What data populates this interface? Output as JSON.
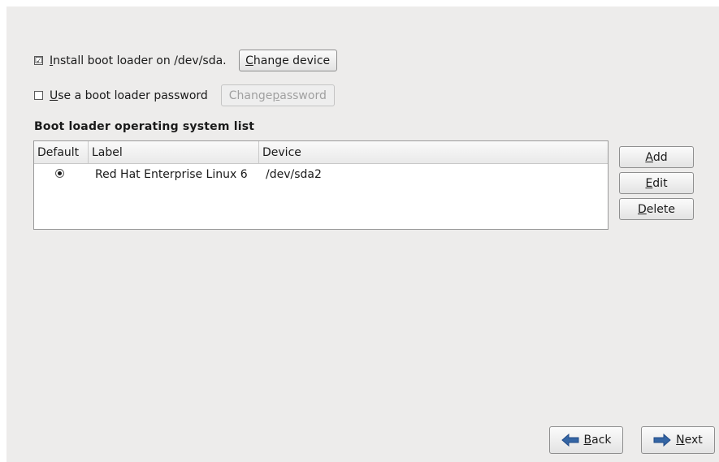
{
  "install": {
    "checked": true,
    "check_glyph": "☑",
    "label_prefix": "I",
    "label_rest": "nstall boot loader on /dev/sda.",
    "change_device_prefix": "C",
    "change_device_rest": "hange device"
  },
  "password": {
    "checked": false,
    "label_prefix": "U",
    "label_rest": "se a boot loader password",
    "change_password_pre": "Change ",
    "change_password_u": "p",
    "change_password_post": "assword"
  },
  "section_title": "Boot loader operating system list",
  "list": {
    "columns": [
      "Default",
      "Label",
      "Device"
    ],
    "rows": [
      {
        "default": true,
        "label": "Red Hat Enterprise Linux 6",
        "device": "/dev/sda2"
      }
    ]
  },
  "side_buttons": {
    "add_u": "A",
    "add_rest": "dd",
    "edit_u": "E",
    "edit_rest": "dit",
    "delete_u": "D",
    "delete_rest": "elete"
  },
  "nav": {
    "back_u": "B",
    "back_rest": "ack",
    "back_icon": "arrow-left-icon",
    "next_u": "N",
    "next_rest": "ext",
    "next_icon": "arrow-right-icon",
    "arrow_color": "#3465a4"
  }
}
